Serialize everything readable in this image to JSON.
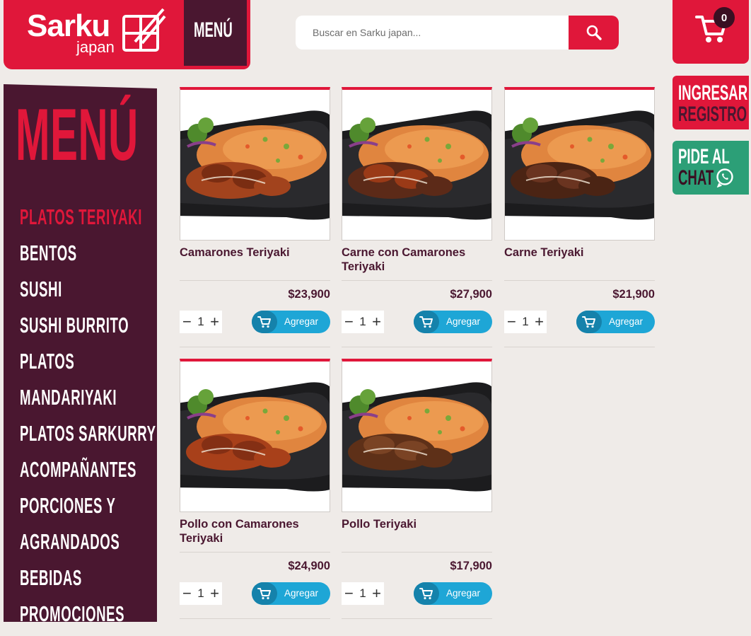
{
  "header": {
    "logo_brand": "Sarku",
    "logo_sub": "japan",
    "menu_tab": "MENÚ",
    "search_placeholder": "Buscar en Sarku japan...",
    "cart_count": "0"
  },
  "side_actions": {
    "login": "INGRESAR",
    "register": "REGISTRO",
    "chat_line1": "PIDE AL",
    "chat_line2": "CHAT"
  },
  "sidebar": {
    "title": "MENÚ",
    "categories": [
      {
        "label": "PLATOS TERIYAKI",
        "active": true
      },
      {
        "label": "BENTOS"
      },
      {
        "label": "SUSHI"
      },
      {
        "label": "SUSHI BURRITO"
      },
      {
        "label": "PLATOS"
      },
      {
        "label": "MANDARIYAKI"
      },
      {
        "label": "PLATOS SARKURRY"
      },
      {
        "label": "ACOMPAÑANTES"
      },
      {
        "label": "PORCIONES Y"
      },
      {
        "label": "AGRANDADOS"
      },
      {
        "label": "BEBIDAS"
      },
      {
        "label": "PROMOCIONES"
      }
    ]
  },
  "products": [
    {
      "name": "Camarones Teriyaki",
      "price": "$23,900",
      "qty": "1",
      "add_label": "Agregar"
    },
    {
      "name": "Carne con Camarones Teriyaki",
      "price": "$27,900",
      "qty": "1",
      "add_label": "Agregar"
    },
    {
      "name": "Carne Teriyaki",
      "price": "$21,900",
      "qty": "1",
      "add_label": "Agregar"
    },
    {
      "name": "Pollo con Camarones Teriyaki",
      "price": "$24,900",
      "qty": "1",
      "add_label": "Agregar"
    },
    {
      "name": "Pollo Teriyaki",
      "price": "$17,900",
      "qty": "1",
      "add_label": "Agregar"
    }
  ],
  "colors": {
    "brand_red": "#e0173a",
    "maroon": "#4a1730",
    "add_blue": "#1ea6d6",
    "chat_green": "#2c9f77"
  }
}
